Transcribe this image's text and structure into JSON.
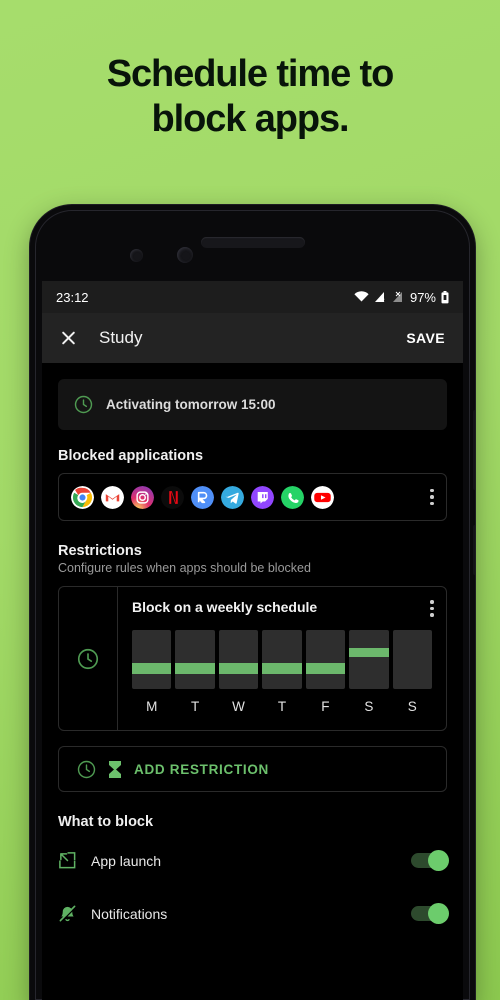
{
  "promo": {
    "line1": "Schedule time to",
    "line2": "block apps.",
    "bg_top": "#a6dd6c",
    "bg_bottom": "#8cc94f",
    "text_color": "#08140a"
  },
  "status_bar": {
    "time": "23:12",
    "battery_percent": "97%",
    "wifi_icon": "wifi-icon",
    "signal_icon": "cell-signal-icon",
    "signal_icon_2": "cell-signal-no-sim-icon",
    "battery_icon": "battery-icon"
  },
  "app_bar": {
    "close_icon": "close-icon",
    "title": "Study",
    "save_label": "SAVE"
  },
  "banner": {
    "icon": "clock-icon",
    "text": "Activating tomorrow 15:00"
  },
  "blocked_apps": {
    "title": "Blocked applications",
    "overflow_icon": "more-vertical-icon",
    "apps": [
      {
        "name": "Chrome"
      },
      {
        "name": "Gmail"
      },
      {
        "name": "Instagram"
      },
      {
        "name": "Netflix"
      },
      {
        "name": "Reddit"
      },
      {
        "name": "Telegram"
      },
      {
        "name": "Twitch"
      },
      {
        "name": "WhatsApp"
      },
      {
        "name": "YouTube"
      }
    ]
  },
  "restrictions": {
    "title": "Restrictions",
    "subtitle": "Configure rules when apps should be blocked",
    "schedule_card": {
      "gutter_icon": "clock-icon",
      "title": "Block on a weekly schedule",
      "overflow_icon": "more-vertical-icon",
      "accent": "#6cb86c",
      "days": [
        {
          "label": "M",
          "block_top_pct": 56,
          "block_height_pct": 18
        },
        {
          "label": "T",
          "block_top_pct": 56,
          "block_height_pct": 18
        },
        {
          "label": "W",
          "block_top_pct": 56,
          "block_height_pct": 18
        },
        {
          "label": "T",
          "block_top_pct": 56,
          "block_height_pct": 18
        },
        {
          "label": "F",
          "block_top_pct": 56,
          "block_height_pct": 18
        },
        {
          "label": "S",
          "block_top_pct": 30,
          "block_height_pct": 15
        },
        {
          "label": "S",
          "block_top_pct": 0,
          "block_height_pct": 0
        }
      ]
    },
    "add_button": {
      "clock_icon": "clock-icon",
      "hourglass_icon": "hourglass-icon",
      "label": "ADD RESTRICTION"
    }
  },
  "what_to_block": {
    "title": "What to block",
    "items": [
      {
        "icon": "external-link-icon",
        "label": "App launch",
        "enabled": true
      },
      {
        "icon": "bell-off-icon",
        "label": "Notifications",
        "enabled": true
      }
    ]
  }
}
